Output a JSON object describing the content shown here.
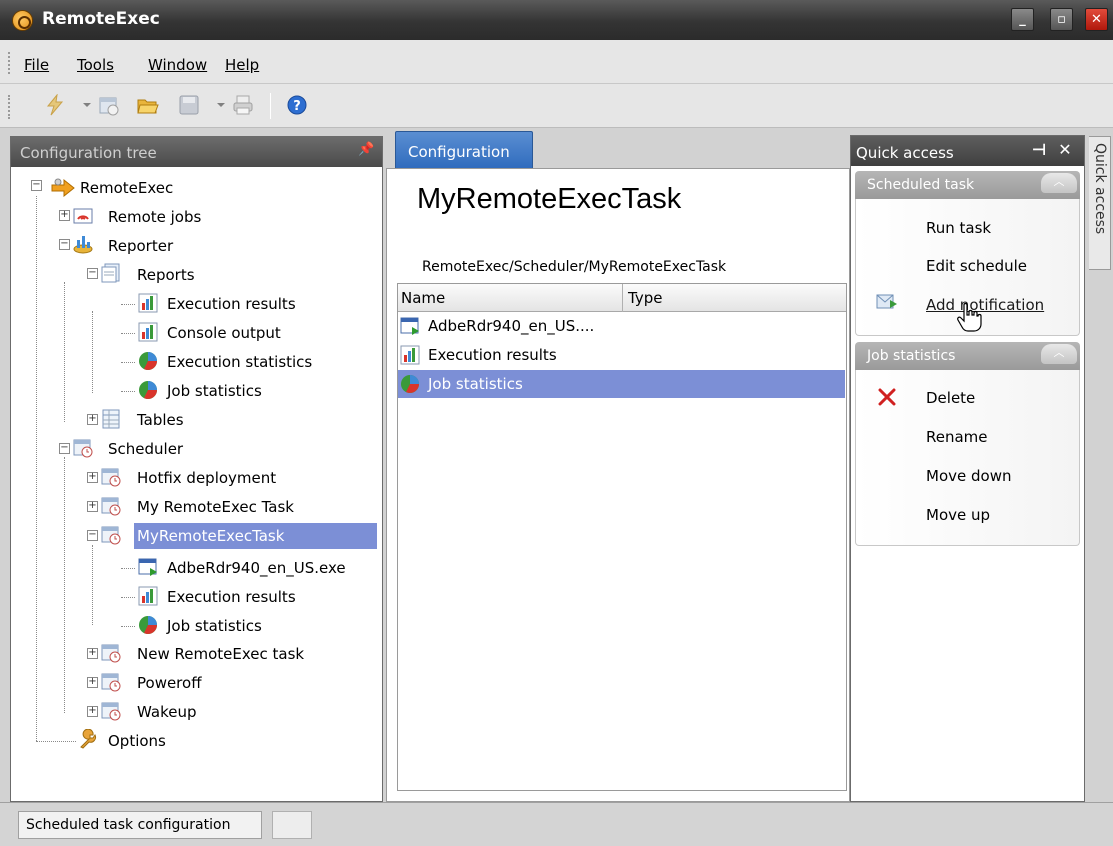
{
  "app": {
    "title": "RemoteExec"
  },
  "menu": {
    "file": "File",
    "tools": "Tools",
    "window": "Window",
    "help": "Help"
  },
  "left_panel": {
    "header": "Configuration tree",
    "tree": [
      {
        "label": "RemoteExec"
      },
      {
        "label": "Remote jobs"
      },
      {
        "label": "Reporter"
      },
      {
        "label": "Reports"
      },
      {
        "label": "Execution results"
      },
      {
        "label": "Console output"
      },
      {
        "label": "Execution statistics"
      },
      {
        "label": "Job statistics"
      },
      {
        "label": "Tables"
      },
      {
        "label": "Scheduler"
      },
      {
        "label": "Hotfix deployment"
      },
      {
        "label": "My RemoteExec Task"
      },
      {
        "label": "MyRemoteExecTask"
      },
      {
        "label": "AdbeRdr940_en_US.exe"
      },
      {
        "label": "Execution results"
      },
      {
        "label": "Job statistics"
      },
      {
        "label": "New RemoteExec task"
      },
      {
        "label": "Poweroff"
      },
      {
        "label": "Wakeup"
      },
      {
        "label": "Options"
      }
    ]
  },
  "center": {
    "tab": "Configuration",
    "title": "MyRemoteExecTask",
    "path": "RemoteExec/Scheduler/MyRemoteExecTask",
    "columns": {
      "name": "Name",
      "type": "Type"
    },
    "rows": [
      {
        "name": "AdbeRdr940_en_US...."
      },
      {
        "name": "Execution results"
      },
      {
        "name": "Job statistics"
      }
    ]
  },
  "quick_access": {
    "header": "Quick access",
    "side_tab": "Quick access",
    "scheduled_section": "Scheduled task",
    "scheduled_items": [
      "Run task",
      "Edit schedule",
      "Add notification"
    ],
    "job_section": "Job statistics",
    "job_items": [
      "Delete",
      "Rename",
      "Move down",
      "Move up"
    ]
  },
  "status": {
    "text": "Scheduled task configuration"
  },
  "colors": {
    "selection": "#7c8fd6",
    "tab_blue": "#3a75c4",
    "title_bar": "#3a3a3a"
  }
}
